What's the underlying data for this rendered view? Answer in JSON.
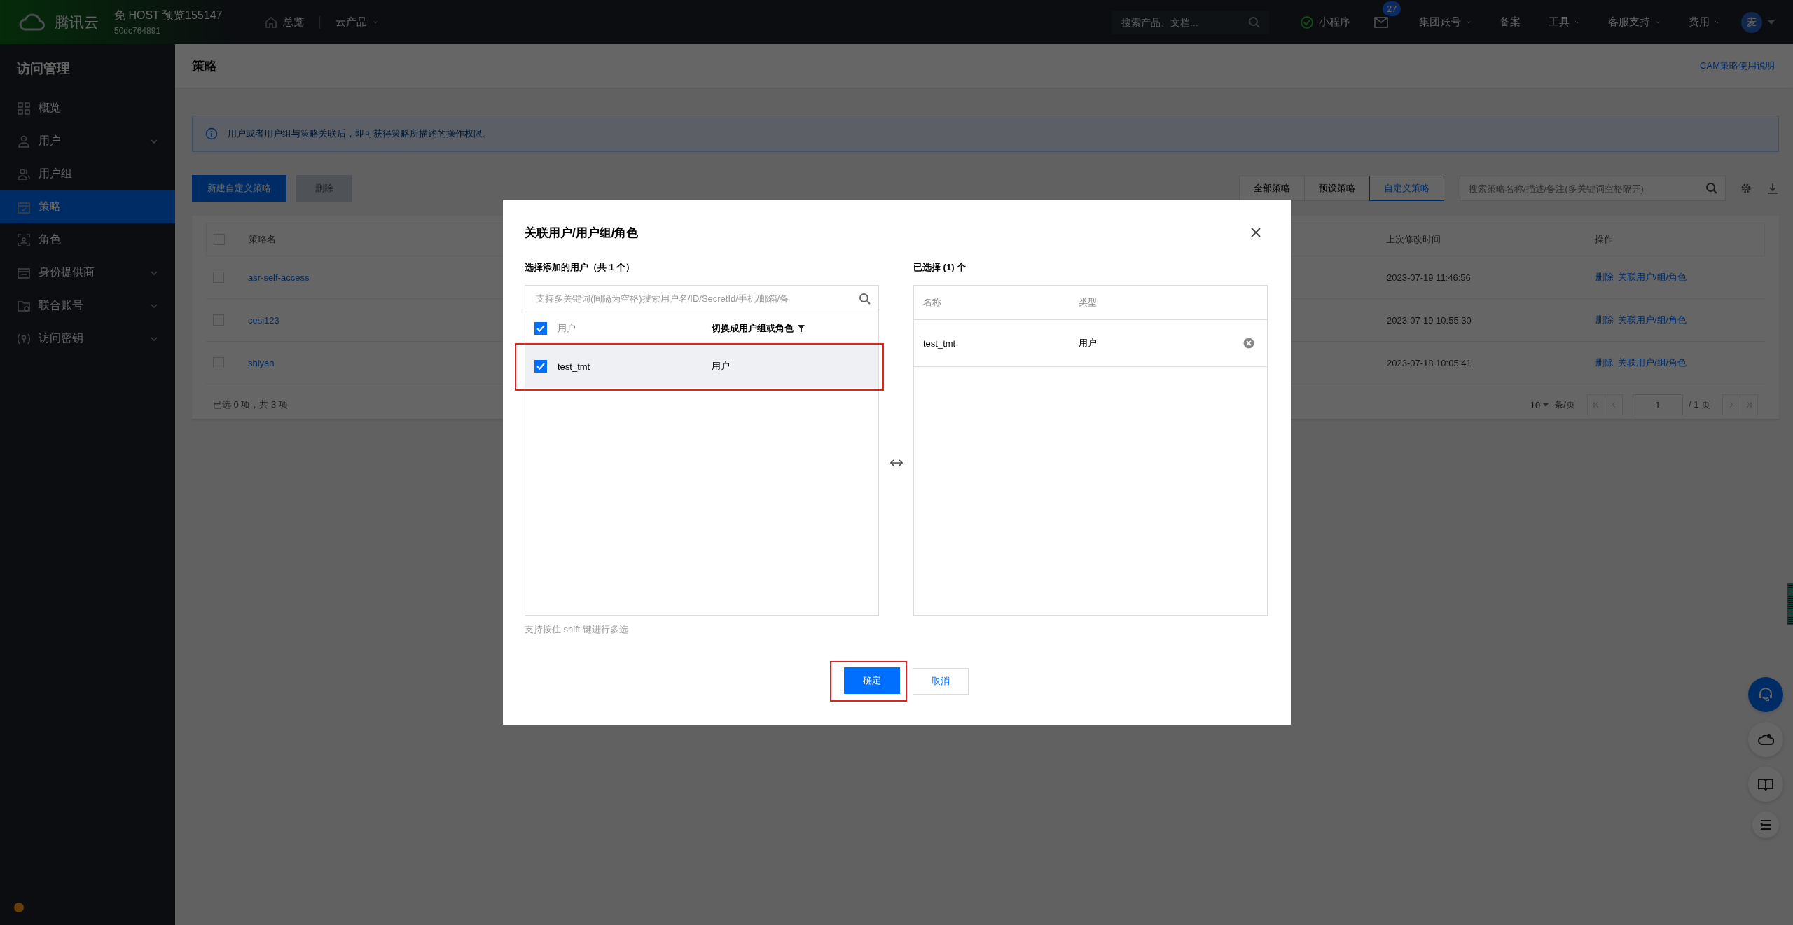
{
  "topbar": {
    "brand": "腾讯云",
    "account_name": "免 HOST 预览155147",
    "account_id": "50dc764891",
    "nav": [
      {
        "label": "总览",
        "kind": "home"
      },
      {
        "label": "云产品",
        "kind": "dropdown"
      }
    ],
    "search": {
      "placeholder": "搜索产品、文档..."
    },
    "right_items": [
      {
        "kind": "miniapp",
        "label": "小程序"
      },
      {
        "kind": "mail",
        "badge": "27"
      },
      {
        "kind": "dropdown",
        "label": "集团账号"
      },
      {
        "kind": "plain",
        "label": "备案"
      },
      {
        "kind": "dropdown",
        "label": "工具"
      },
      {
        "kind": "dropdown",
        "label": "客服支持"
      },
      {
        "kind": "dropdown",
        "label": "费用"
      }
    ],
    "avatar": "麦"
  },
  "sidebar": {
    "title": "访问管理",
    "items": [
      {
        "label": "概览",
        "collapsible": false,
        "selected": false
      },
      {
        "label": "用户",
        "collapsible": true,
        "selected": false
      },
      {
        "label": "用户组",
        "collapsible": false,
        "selected": false
      },
      {
        "label": "策略",
        "collapsible": false,
        "selected": true
      },
      {
        "label": "角色",
        "collapsible": false,
        "selected": false
      },
      {
        "label": "身份提供商",
        "collapsible": true,
        "selected": false
      },
      {
        "label": "联合账号",
        "collapsible": true,
        "selected": false
      },
      {
        "label": "访问密钥",
        "collapsible": true,
        "selected": false
      }
    ]
  },
  "page": {
    "title": "策略",
    "help_link": "CAM策略使用说明",
    "info": "用户或者用户组与策略关联后，即可获得策略所描述的操作权限。",
    "actions": [
      {
        "label": "新建自定义策略",
        "disabled": false
      },
      {
        "label": "删除",
        "disabled": true
      }
    ],
    "filter_tabs": [
      {
        "label": "全部策略",
        "selected": false
      },
      {
        "label": "预设策略",
        "selected": false
      },
      {
        "label": "自定义策略",
        "selected": true
      }
    ],
    "search": {
      "placeholder": "搜索策略名称/描述/备注(多关键词空格隔开)"
    },
    "table": {
      "select_all": false,
      "columns": [
        "策略名",
        "上次修改时间",
        "操作"
      ],
      "rows": [
        {
          "name": "asr-self-access",
          "modified": "2023-07-19 11:46:56",
          "actions": [
            "删除",
            "关联用户/组/角色"
          ],
          "checked": false
        },
        {
          "name": "cesi123",
          "modified": "2023-07-19 10:55:30",
          "actions": [
            "删除",
            "关联用户/组/角色"
          ],
          "checked": false
        },
        {
          "name": "shiyan",
          "modified": "2023-07-18 10:05:41",
          "actions": [
            "删除",
            "关联用户/组/角色"
          ],
          "checked": false
        }
      ]
    },
    "footer": {
      "summary": "已选 0 项，共 3 项",
      "page_size": "10",
      "page_size_unit": "条/页",
      "page": "1",
      "total_pages": "/ 1 页"
    }
  },
  "modal": {
    "title": "关联用户/用户组/角色",
    "left": {
      "label": "选择添加的用户（共 1 个）",
      "placeholder": "支持多关键词(间隔为空格)搜索用户名/ID/SecretId/手机/邮箱/备",
      "select_all": true,
      "column": "用户",
      "switch": "切换成用户组或角色",
      "rows": [
        {
          "name": "test_tmt",
          "type": "用户",
          "checked": true,
          "selected": true,
          "highlighted": true
        }
      ]
    },
    "hint": "支持按住 shift 键进行多选",
    "right": {
      "label": "已选择 (1) 个",
      "columns": [
        "名称",
        "类型"
      ],
      "rows": [
        {
          "name": "test_tmt",
          "type": "用户"
        }
      ]
    },
    "buttons": [
      {
        "label": "确定",
        "kind": "primary",
        "highlighted": true
      },
      {
        "label": "取消",
        "kind": "secondary",
        "highlighted": false
      }
    ]
  }
}
